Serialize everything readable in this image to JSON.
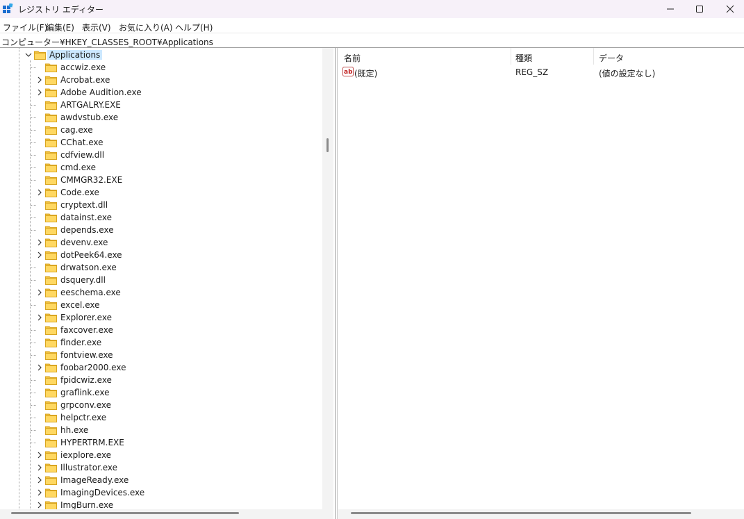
{
  "window": {
    "title": "レジストリ エディター",
    "app_icon": "regedit-icon",
    "controls": [
      "minimize-icon",
      "maximize-icon",
      "close-icon"
    ]
  },
  "menu": {
    "items": [
      "ファイル(F)",
      "編集(E)",
      "表示(V)",
      "お気に入り(A)",
      "ヘルプ(H)"
    ]
  },
  "address": {
    "path": "コンピューター¥HKEY_CLASSES_ROOT¥Applications"
  },
  "tree": {
    "root": "Applications",
    "items": [
      {
        "label": "accwiz.exe",
        "expandable": false
      },
      {
        "label": "Acrobat.exe",
        "expandable": true
      },
      {
        "label": "Adobe Audition.exe",
        "expandable": true
      },
      {
        "label": "ARTGALRY.EXE",
        "expandable": false
      },
      {
        "label": "awdvstub.exe",
        "expandable": false
      },
      {
        "label": "cag.exe",
        "expandable": false
      },
      {
        "label": "CChat.exe",
        "expandable": false
      },
      {
        "label": "cdfview.dll",
        "expandable": false
      },
      {
        "label": "cmd.exe",
        "expandable": false
      },
      {
        "label": "CMMGR32.EXE",
        "expandable": false
      },
      {
        "label": "Code.exe",
        "expandable": true
      },
      {
        "label": "cryptext.dll",
        "expandable": false
      },
      {
        "label": "datainst.exe",
        "expandable": false
      },
      {
        "label": "depends.exe",
        "expandable": false
      },
      {
        "label": "devenv.exe",
        "expandable": true
      },
      {
        "label": "dotPeek64.exe",
        "expandable": true
      },
      {
        "label": "drwatson.exe",
        "expandable": false
      },
      {
        "label": "dsquery.dll",
        "expandable": false
      },
      {
        "label": "eeschema.exe",
        "expandable": true
      },
      {
        "label": "excel.exe",
        "expandable": false
      },
      {
        "label": "Explorer.exe",
        "expandable": true
      },
      {
        "label": "faxcover.exe",
        "expandable": false
      },
      {
        "label": "finder.exe",
        "expandable": false
      },
      {
        "label": "fontview.exe",
        "expandable": false
      },
      {
        "label": "foobar2000.exe",
        "expandable": true
      },
      {
        "label": "fpidcwiz.exe",
        "expandable": false
      },
      {
        "label": "graflink.exe",
        "expandable": false
      },
      {
        "label": "grpconv.exe",
        "expandable": false
      },
      {
        "label": "helpctr.exe",
        "expandable": false
      },
      {
        "label": "hh.exe",
        "expandable": false
      },
      {
        "label": "HYPERTRM.EXE",
        "expandable": false
      },
      {
        "label": "iexplore.exe",
        "expandable": true
      },
      {
        "label": "Illustrator.exe",
        "expandable": true
      },
      {
        "label": "ImageReady.exe",
        "expandable": true
      },
      {
        "label": "ImagingDevices.exe",
        "expandable": true
      },
      {
        "label": "ImgBurn.exe",
        "expandable": true
      }
    ]
  },
  "list": {
    "columns": [
      "名前",
      "種類",
      "データ"
    ],
    "rows": [
      {
        "icon": "string-value-icon",
        "name": "(既定)",
        "type": "REG_SZ",
        "data": "(値の設定なし)"
      }
    ]
  }
}
